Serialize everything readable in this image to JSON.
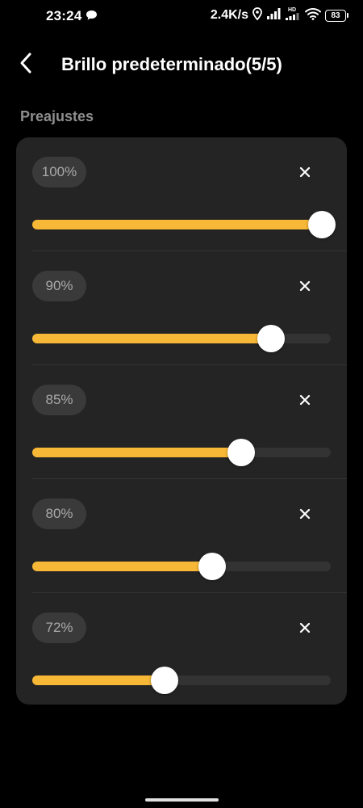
{
  "status_bar": {
    "time": "23:24",
    "net_speed": "2.4K/s",
    "battery": "83",
    "icons": [
      "chat-bubble-icon",
      "location-icon",
      "signal-icon",
      "hd-signal-icon",
      "wifi-icon",
      "battery-icon"
    ]
  },
  "header": {
    "title": "Brillo predeterminado(5/5)",
    "back_icon": "chevron-left-icon"
  },
  "section": {
    "label": "Preajustes"
  },
  "presets": [
    {
      "label": "100%",
      "value": 100
    },
    {
      "label": "90%",
      "value": 90
    },
    {
      "label": "85%",
      "value": 85
    },
    {
      "label": "80%",
      "value": 80
    },
    {
      "label": "72%",
      "value": 72
    }
  ],
  "colors": {
    "background": "#000000",
    "card": "#242424",
    "accent": "#f7b737",
    "track": "#333333",
    "pill": "#3a3a3a",
    "muted_text": "#8e8e8e"
  }
}
